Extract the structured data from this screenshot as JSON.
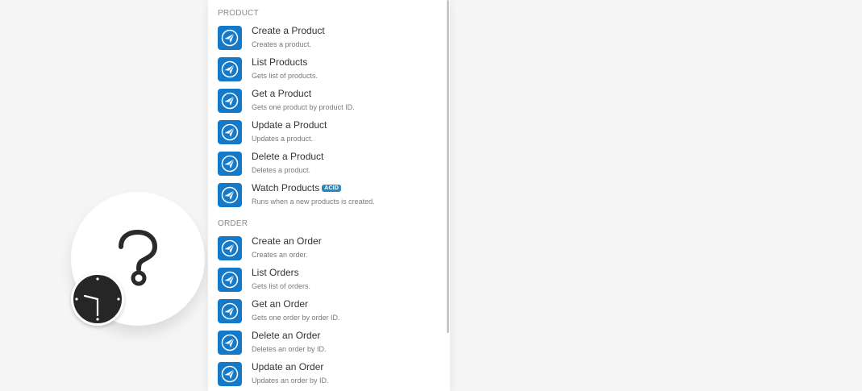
{
  "colors": {
    "canvas_bg": "#f5f5f5",
    "icon_bg": "#1379c8",
    "badge_bg": "#2c8ab8",
    "title_text": "#333333",
    "desc_text": "#7a7a7a"
  },
  "canvas": {
    "module_icon": "question-mark-icon",
    "scheduler_icon": "clock-icon"
  },
  "sections": [
    {
      "header": "PRODUCT",
      "items": [
        {
          "title": "Create a Product",
          "desc": "Creates a product.",
          "icon": "app-logo-icon"
        },
        {
          "title": "List Products",
          "desc": "Gets list of products.",
          "icon": "app-logo-icon"
        },
        {
          "title": "Get a Product",
          "desc": "Gets one product by product ID.",
          "icon": "app-logo-icon"
        },
        {
          "title": "Update a Product",
          "desc": "Updates a product.",
          "icon": "app-logo-icon"
        },
        {
          "title": "Delete a Product",
          "desc": "Deletes a product.",
          "icon": "app-logo-icon"
        },
        {
          "title": "Watch Products",
          "badge": "ACID",
          "desc": "Runs when a new products is created.",
          "icon": "app-logo-icon"
        }
      ]
    },
    {
      "header": "ORDER",
      "items": [
        {
          "title": "Create an Order",
          "desc": "Creates an order.",
          "icon": "app-logo-icon"
        },
        {
          "title": "List Orders",
          "desc": "Gets list of orders.",
          "icon": "app-logo-icon"
        },
        {
          "title": "Get an Order",
          "desc": "Gets one order by order ID.",
          "icon": "app-logo-icon"
        },
        {
          "title": "Delete an Order",
          "desc": "Deletes an order by ID.",
          "icon": "app-logo-icon"
        },
        {
          "title": "Update an Order",
          "desc": "Updates an order by ID.",
          "icon": "app-logo-icon"
        }
      ]
    }
  ]
}
